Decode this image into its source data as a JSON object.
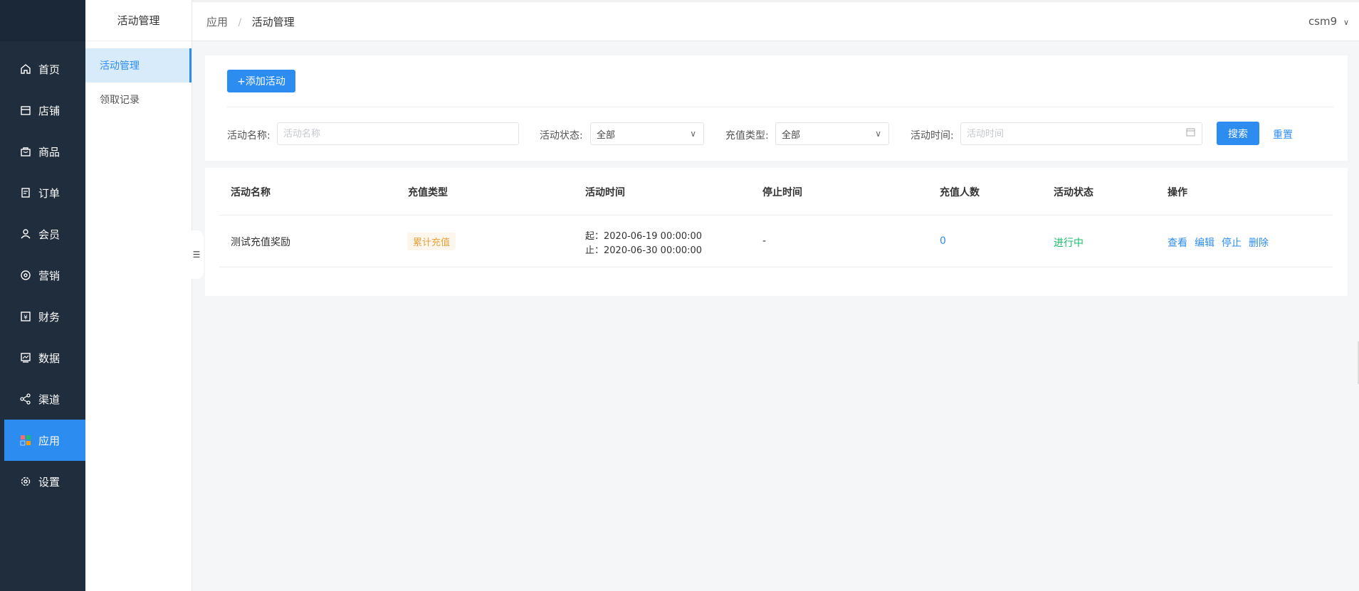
{
  "nav": {
    "items": [
      {
        "label": "首页",
        "icon": "home-icon"
      },
      {
        "label": "店铺",
        "icon": "store-icon"
      },
      {
        "label": "商品",
        "icon": "bag-icon"
      },
      {
        "label": "订单",
        "icon": "order-icon"
      },
      {
        "label": "会员",
        "icon": "user-icon"
      },
      {
        "label": "营销",
        "icon": "marketing-icon"
      },
      {
        "label": "财务",
        "icon": "yen-icon"
      },
      {
        "label": "数据",
        "icon": "chart-icon"
      },
      {
        "label": "渠道",
        "icon": "share-icon"
      },
      {
        "label": "应用",
        "icon": "apps-icon"
      },
      {
        "label": "设置",
        "icon": "gear-icon"
      }
    ],
    "active_index": 9,
    "accent": "#2d8cf0"
  },
  "subnav": {
    "title": "活动管理",
    "items": [
      "活动管理",
      "领取记录"
    ]
  },
  "header": {
    "breadcrumb": [
      "应用",
      "活动管理"
    ],
    "separator": "/",
    "user": "csm9"
  },
  "filters": {
    "add_button": "+添加活动",
    "name_label": "活动名称:",
    "name_placeholder": "活动名称",
    "status_label": "活动状态:",
    "status_value": "全部",
    "type_label": "充值类型:",
    "type_value": "全部",
    "time_label": "活动时间:",
    "time_placeholder": "活动时间",
    "search_button": "搜索",
    "reset_button": "重置"
  },
  "table": {
    "columns": [
      "活动名称",
      "充值类型",
      "活动时间",
      "停止时间",
      "充值人数",
      "活动状态",
      "操作"
    ],
    "rows": [
      {
        "name": "测试充值奖励",
        "type": "累计充值",
        "start": "起：2020-06-19 00:00:00",
        "end": "止：2020-06-30 00:00:00",
        "stop_time": "-",
        "count": "0",
        "status": "进行中",
        "actions": [
          "查看",
          "编辑",
          "停止",
          "删除"
        ]
      }
    ]
  }
}
